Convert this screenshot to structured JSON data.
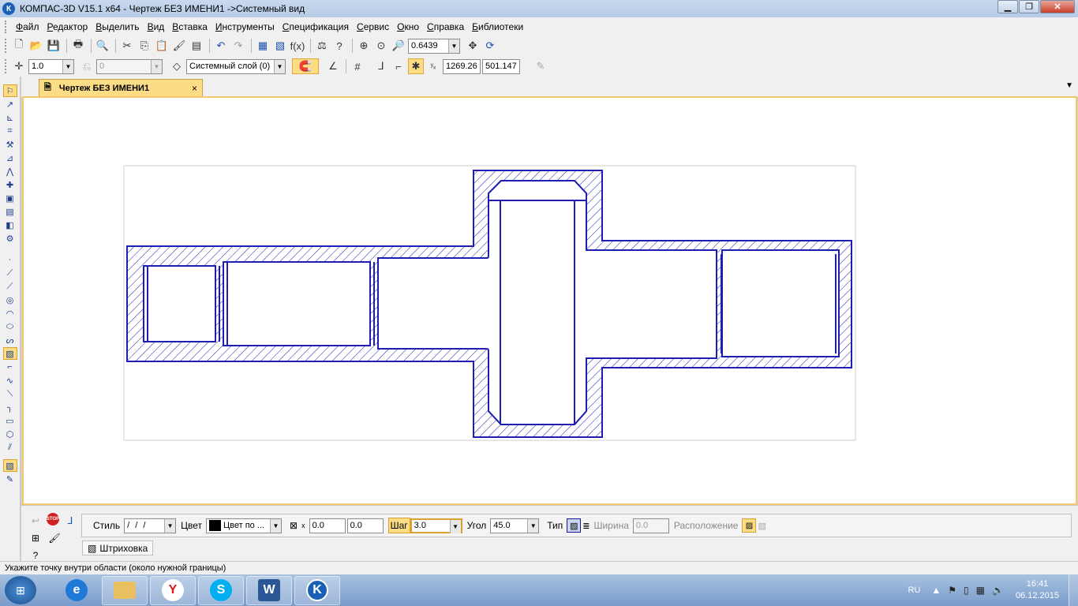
{
  "window": {
    "title": "КОМПАС-3D V15.1 x64 - Чертеж БЕЗ ИМЕНИ1 ->Системный вид",
    "logo": "К",
    "minimize": "▁",
    "restore": "❐",
    "close": "✕"
  },
  "menu": [
    "Файл",
    "Редактор",
    "Выделить",
    "Вид",
    "Вставка",
    "Инструменты",
    "Спецификация",
    "Сервис",
    "Окно",
    "Справка",
    "Библиотеки"
  ],
  "toolbar1": {
    "zoom_value": "0.6439"
  },
  "toolbar2": {
    "line_scale": "1.0",
    "state_value": "0",
    "layer": "Системный слой (0)",
    "coord_x": "1269.26",
    "coord_y": "501.147"
  },
  "document_tab": {
    "label": "Чертеж БЕЗ ИМЕНИ1",
    "close": "×"
  },
  "property_panel": {
    "style_label": "Стиль",
    "color_label": "Цвет",
    "color_value": "Цвет по ...",
    "x_label": "x",
    "x_value": "0.0",
    "y_value": "0.0",
    "step_label": "Шаг",
    "step_value": "3.0",
    "angle_label": "Угол",
    "angle_value": "45.0",
    "type_label": "Тип",
    "width_label": "Ширина",
    "width_value": "0.0",
    "placement_label": "Расположение",
    "subtab_label": "Штриховка"
  },
  "status_text": "Укажите точку внутри области (около нужной границы)",
  "taskbar": {
    "lang": "RU",
    "time": "16:41",
    "date": "06.12.2015"
  },
  "colors": {
    "accent": "#fddc86",
    "drawing_line": "#1e1eb4",
    "title_bar": "#b6cbe6",
    "taskbar": "#7a9ccb"
  }
}
